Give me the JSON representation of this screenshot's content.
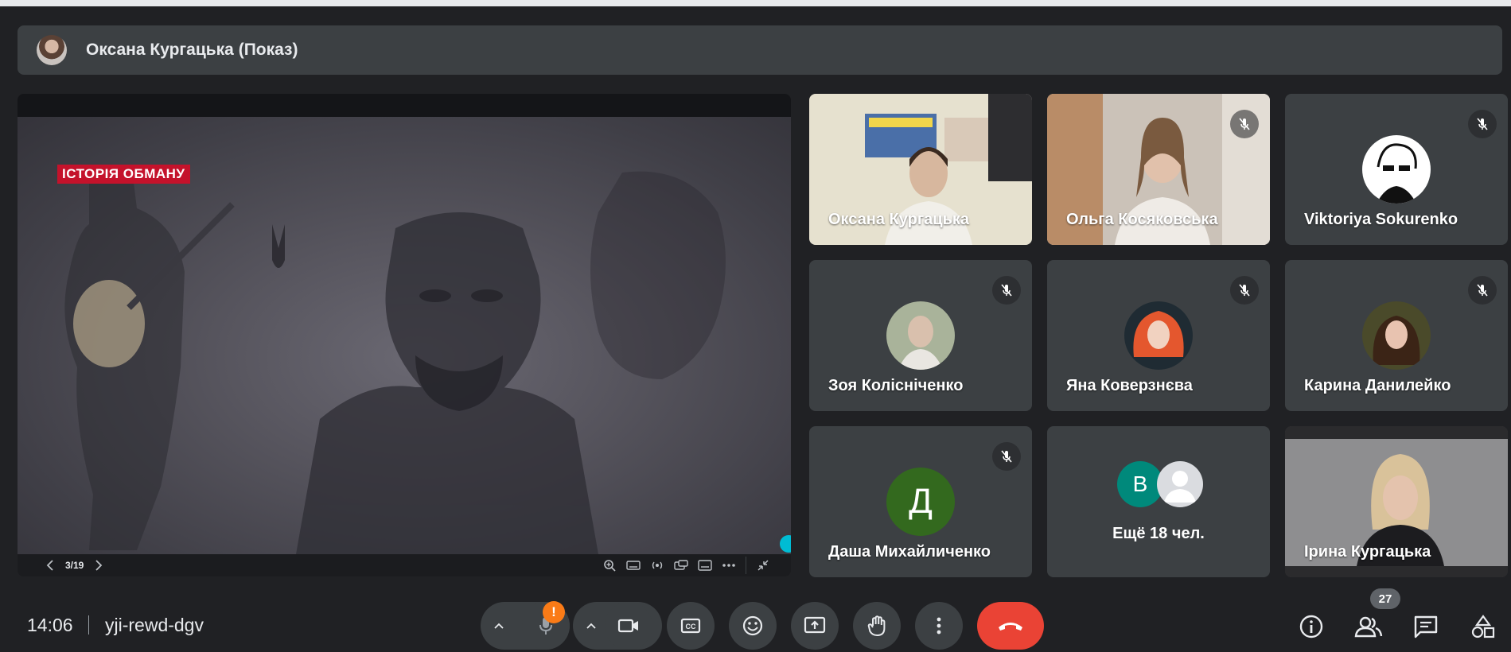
{
  "presenter": {
    "name": "Оксана Кургацька (Показ)"
  },
  "presentation": {
    "slide_tag": "ІСТОРІЯ ОБМАНУ",
    "page_indicator": "3/19",
    "progress": 0.155
  },
  "participants": [
    {
      "name": "Оксана Кургацька",
      "muted": false,
      "video": true
    },
    {
      "name": "Ольга Косяковська",
      "muted": true,
      "video": true
    },
    {
      "name": "Viktoriya Sokurenko",
      "muted": true,
      "video": false
    },
    {
      "name": "Зоя Колісніченко",
      "muted": true,
      "video": false
    },
    {
      "name": "Яна Коверзнєва",
      "muted": true,
      "video": false
    },
    {
      "name": "Карина Данилейко",
      "muted": true,
      "video": false
    },
    {
      "name": "Даша Михайличенко",
      "muted": true,
      "video": false,
      "initial": "Д"
    },
    {
      "name": "Ірина Кургацька",
      "muted": false,
      "video": true
    }
  ],
  "more": {
    "label": "Ещё 18 чел.",
    "initial": "В"
  },
  "bottom": {
    "time": "14:06",
    "meeting_code": "yji-rewd-dgv",
    "alert": "!",
    "people_count": "27"
  },
  "colors": {
    "accent": "#00bcd4",
    "end_call": "#ea4335",
    "alert": "#fa7b17",
    "avatar_green": "#33691e",
    "avatar_teal": "#00897b"
  }
}
